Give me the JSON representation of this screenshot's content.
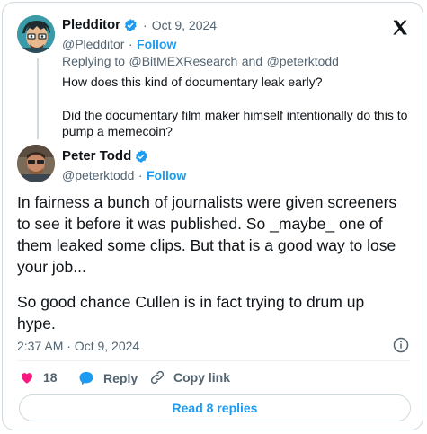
{
  "parent": {
    "name": "Pledditor",
    "handle": "@Pledditor",
    "dot": "·",
    "date": "Oct 9, 2024",
    "follow": "Follow",
    "replying_prefix": "Replying to",
    "reply_to_1": "@BitMEXResearch",
    "reply_and": "and",
    "reply_to_2": "@peterktodd",
    "text_line1": "How does this kind of documentary leak early?",
    "text_line2": "Did the documentary film maker himself intentionally do this to",
    "text_line3": "pump a memecoin?"
  },
  "main": {
    "name": "Peter Todd",
    "handle": "@peterktodd",
    "dot": "·",
    "follow": "Follow",
    "text_p1_l1": "In fairness a bunch of journalists were given screeners",
    "text_p1_l2": "to see it before it was published. So _maybe_ one of",
    "text_p1_l3": "them leaked some clips. But that is a good way to lose",
    "text_p1_l4": "your job...",
    "text_p2_l1": "So good chance Cullen is in fact trying to drum up",
    "text_p2_l2": "hype.",
    "timestamp": "2:37 AM · Oct 9, 2024"
  },
  "actions": {
    "like_count": "18",
    "reply_label": "Reply",
    "copy_label": "Copy link"
  },
  "read_replies": "Read 8 replies",
  "colors": {
    "accent": "#1d9bf0",
    "like": "#f91880",
    "muted": "#536471"
  },
  "icons": [
    "x-logo-icon",
    "verified-badge-icon",
    "heart-icon",
    "reply-bubble-icon",
    "link-icon",
    "info-icon"
  ]
}
